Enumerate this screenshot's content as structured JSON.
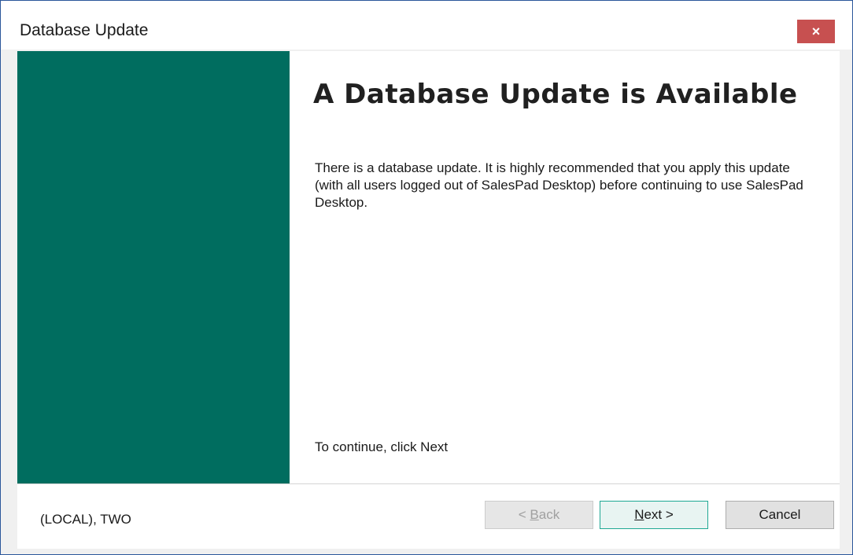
{
  "window": {
    "title": "Database Update",
    "close_glyph": "×"
  },
  "main": {
    "heading": "A Database Update is Available",
    "description": "There is a database update.  It is highly recommended that you apply this update (with all users logged out of SalesPad Desktop) before continuing to use SalesPad Desktop.",
    "continue_text": "To continue, click Next"
  },
  "footer": {
    "server_label": "(LOCAL), TWO",
    "back_prefix": "< ",
    "back_mnemonic": "B",
    "back_rest": "ack",
    "next_mnemonic": "N",
    "next_rest": "ext >",
    "cancel_label": "Cancel"
  },
  "colors": {
    "banner": "#006d5f",
    "close_button": "#c75050",
    "next_border": "#1fa894"
  }
}
